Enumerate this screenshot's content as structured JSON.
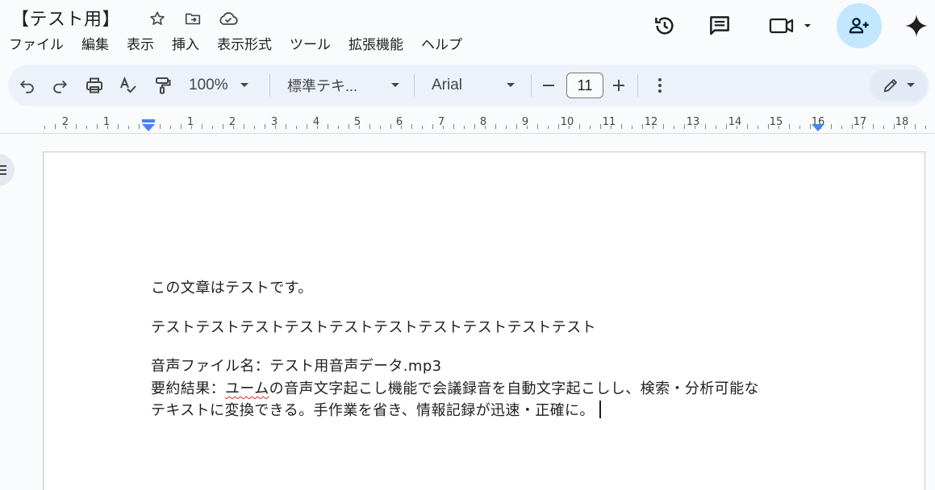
{
  "document": {
    "title": "【テスト用】"
  },
  "menubar": {
    "items": [
      "ファイル",
      "編集",
      "表示",
      "挿入",
      "表示形式",
      "ツール",
      "拡張機能",
      "ヘルプ"
    ]
  },
  "toolbar": {
    "zoom": "100%",
    "style": "標準テキ...",
    "font": "Arial",
    "font_size": "11"
  },
  "ruler": {
    "numbers": [
      "2",
      "1",
      "1",
      "2",
      "3",
      "4",
      "5",
      "6",
      "7",
      "8",
      "9",
      "10",
      "11",
      "12",
      "13",
      "14",
      "15",
      "16",
      "17",
      "18"
    ]
  },
  "body": {
    "line1": "この文章はテストです。",
    "line2": "テストテストテストテストテストテストテストテストテストテスト",
    "line3": "音声ファイル名：テスト用音声データ.mp3",
    "line4_pre": "要約結果：",
    "line4_misspelled": "ユーム",
    "line4_post": "の音声文字起こし機能で会議録音を自動文字起こしし、検索・分析可能な",
    "line5": "テキストに変換できる。手作業を省き、情報記録が迅速・正確に。"
  },
  "colors": {
    "accent": "#0b57d0",
    "share_bg": "#c2e7ff",
    "toolbar_bg": "#edf2fa",
    "ruler_marker": "#4285f4",
    "spell_error": "#d93025"
  },
  "icons": {
    "star": "star-icon",
    "move": "move-to-folder-icon",
    "cloud": "cloud-saved-icon",
    "history": "history-icon",
    "comments": "comments-icon",
    "meet": "video-camera-icon",
    "share": "person-add-icon",
    "gemini": "gemini-sparkle-icon"
  }
}
